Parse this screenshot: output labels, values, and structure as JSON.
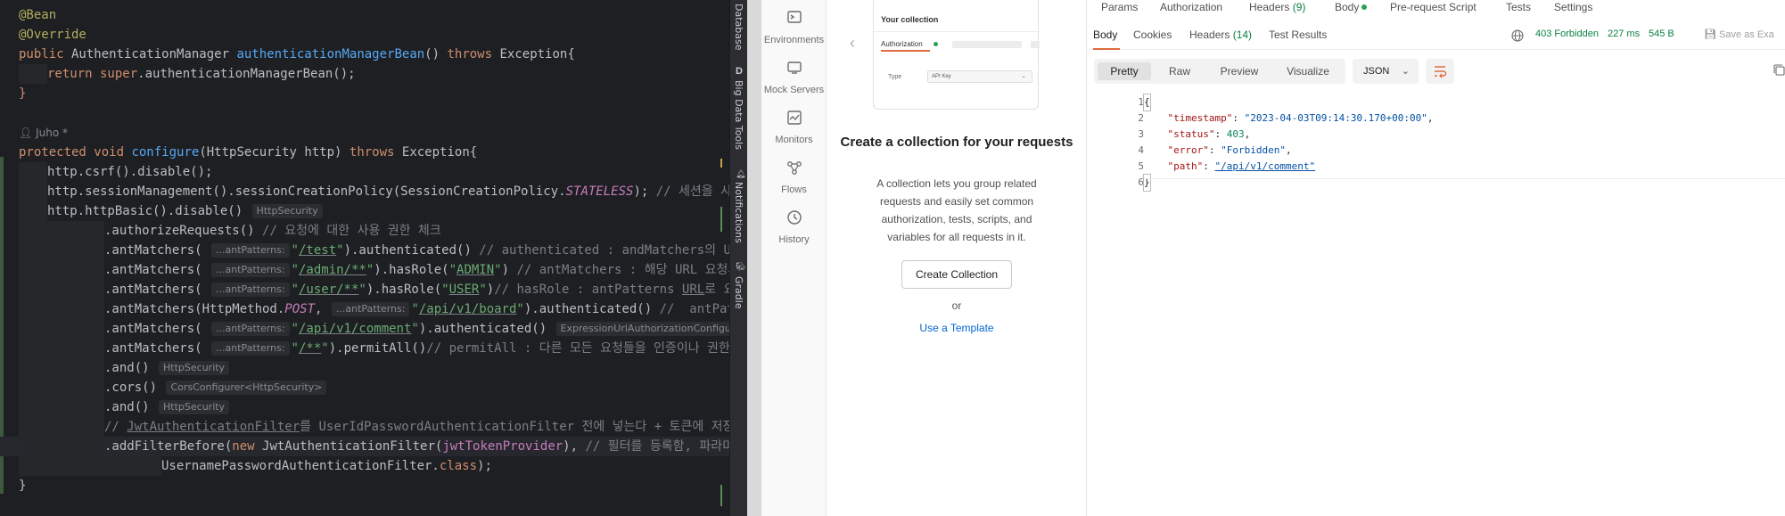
{
  "ide": {
    "lines": [
      {
        "t": "@Bean"
      },
      {
        "t": "@Override"
      },
      {
        "t": "public AuthenticationManager authenticationManagerBean() throws Exception{"
      },
      {
        "t": "return super.authenticationManagerBean();"
      },
      {
        "t": "}"
      },
      {
        "t": ""
      },
      {
        "t": "Juho *"
      },
      {
        "t": "protected void configure(HttpSecurity http) throws Exception{"
      },
      {
        "t": "http.csrf().disable();"
      },
      {
        "t": "http.sessionManagement().sessionCreationPolicy(SessionCreationPolicy.STATELESS); // 세션을 사용하지"
      },
      {
        "t": "http.httpBasic().disable()"
      },
      {
        "t": ".authorizeRequests() // 요청에 대한 사용 권한 체크"
      },
      {
        "t": ".antMatchers( \"/test\").authenticated() // authenticated : andMatchers의 URL로"
      },
      {
        "t": ".antMatchers( \"/admin/**\").hasRole(\"ADMIN\") // antMatchers : 해당 URL 요청시 설정"
      },
      {
        "t": ".antMatchers( \"/user/**\").hasRole(\"USER\")// hasRole : antPatterns URL로 요청이"
      },
      {
        "t": ".antMatchers(HttpMethod.POST, \"/api/v1/board\").authenticated() //  antPatterns"
      },
      {
        "t": ".antMatchers( \"/api/v1/comment\").authenticated()"
      },
      {
        "t": ".antMatchers( \"/**\").permitAll()// permitAll : 다른 모든 요청들을 인증이나 권한 없이"
      },
      {
        "t": ".and()"
      },
      {
        "t": ".cors()"
      },
      {
        "t": ".and()"
      },
      {
        "t": "// JwtAuthenticationFilter를 UserIdPasswordAuthenticationFilter 전에 넣는다 + 토큰에 저장된"
      },
      {
        "t": ".addFilterBefore(new JwtAuthenticationFilter(jwtTokenProvider), // 필터를 등록함, 파라미터"
      },
      {
        "t": "UsernamePasswordAuthenticationFilter.class);"
      },
      {
        "t": "}"
      }
    ],
    "hints": {
      "http_security": "HttpSecurity",
      "ant_patterns": "...antPatterns:",
      "expr_url": "ExpressionUrlAuthorizationConfigurer<...>",
      "cors_configurer": "CorsConfigurer<HttpSecurity>"
    },
    "author": "Juho *"
  },
  "tool_strip": {
    "items": [
      "Database",
      "Big Data Tools",
      "Notifications",
      "Gradle"
    ],
    "bigdata_glyph": "D"
  },
  "postman_nav": {
    "items": [
      {
        "label": "Environments",
        "icon": "environments-icon"
      },
      {
        "label": "Mock Servers",
        "icon": "mock-servers-icon"
      },
      {
        "label": "Monitors",
        "icon": "monitors-icon"
      },
      {
        "label": "Flows",
        "icon": "flows-icon"
      },
      {
        "label": "History",
        "icon": "history-icon"
      }
    ]
  },
  "collection_panel": {
    "card": {
      "title": "Your collection",
      "tab": "Authorization",
      "type_label": "Type",
      "type_value": "API Key"
    },
    "heading": "Create a collection for your requests",
    "description": "A collection lets you group related requests and easily set common authorization, tests, scripts, and variables for all requests in it.",
    "create_button": "Create Collection",
    "or": "or",
    "template_link": "Use a Template"
  },
  "response": {
    "request_tabs": [
      {
        "label": "Params"
      },
      {
        "label": "Authorization"
      },
      {
        "label": "Headers",
        "count": "(9)"
      },
      {
        "label": "Body"
      },
      {
        "label": "Pre-request Script"
      },
      {
        "label": "Tests"
      },
      {
        "label": "Settings"
      }
    ],
    "body_tabs": [
      "Body",
      "Cookies",
      "Headers",
      "Test Results"
    ],
    "headers_count": "(14)",
    "status": {
      "code": "403 Forbidden",
      "time": "227 ms",
      "size": "545 B",
      "save": "Save as Exa"
    },
    "view_tabs": [
      "Pretty",
      "Raw",
      "Preview",
      "Visualize"
    ],
    "format": "JSON",
    "json_lines": [
      {
        "n": "1",
        "t": "{"
      },
      {
        "n": "2",
        "key": "\"timestamp\"",
        "val": "\"2023-04-03T09:14:30.170+00:00\"",
        "kind": "str"
      },
      {
        "n": "3",
        "key": "\"status\"",
        "val": "403",
        "kind": "num"
      },
      {
        "n": "4",
        "key": "\"error\"",
        "val": "\"Forbidden\"",
        "kind": "str"
      },
      {
        "n": "5",
        "key": "\"path\"",
        "val": "\"/api/v1/comment\"",
        "kind": "link"
      },
      {
        "n": "6",
        "t": "}"
      }
    ]
  }
}
